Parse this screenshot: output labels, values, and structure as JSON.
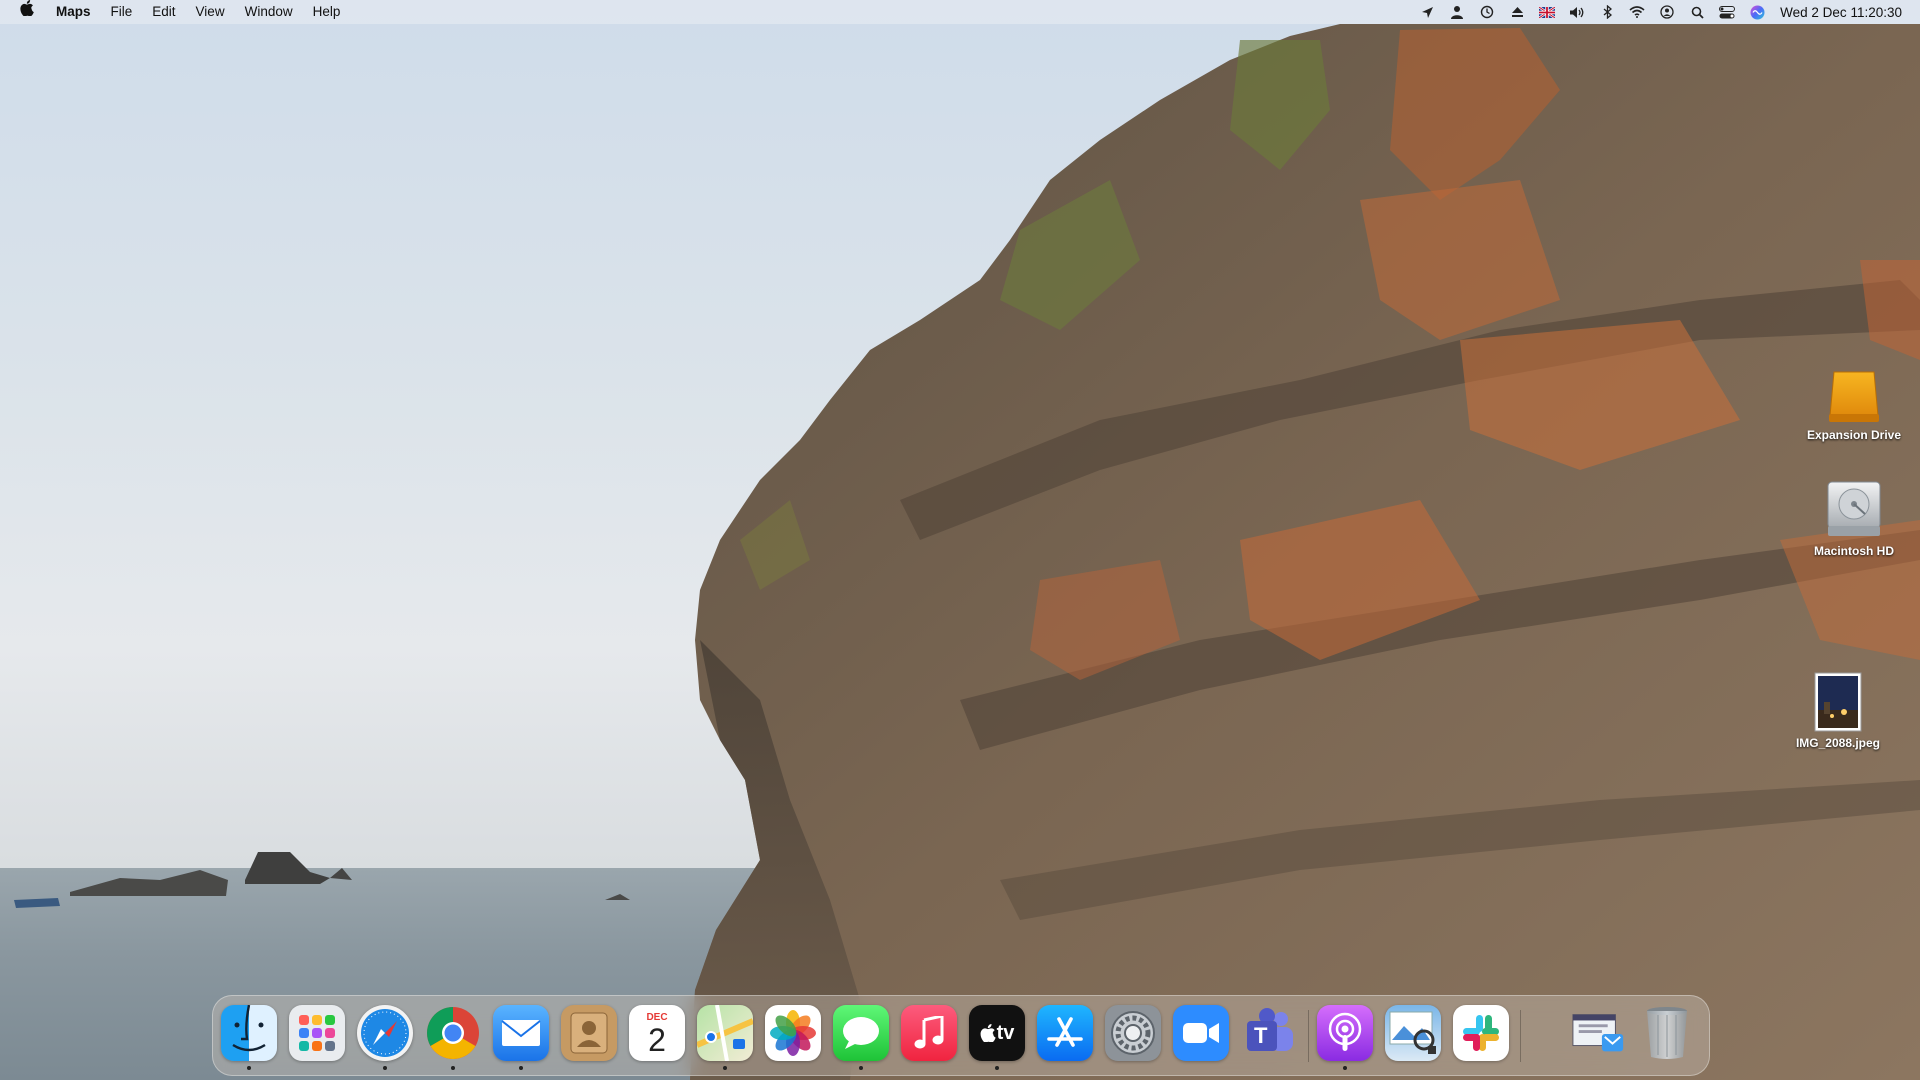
{
  "menubar": {
    "app_name": "Maps",
    "menus": [
      "File",
      "Edit",
      "View",
      "Window",
      "Help"
    ],
    "clock": "Wed 2 Dec  11:20:30",
    "status_icons": [
      "location-arrow-icon",
      "user-icon",
      "time-machine-icon",
      "eject-icon",
      "uk-flag-icon",
      "volume-icon",
      "bluetooth-icon",
      "wifi-icon",
      "user-circle-icon",
      "search-icon",
      "control-center-icon",
      "siri-icon"
    ]
  },
  "desktop": {
    "items": [
      {
        "label": "Expansion Drive",
        "icon": "external-drive-icon"
      },
      {
        "label": "Macintosh HD",
        "icon": "hard-drive-icon"
      },
      {
        "label": "IMG_2088.jpeg",
        "icon": "image-file-icon"
      }
    ]
  },
  "dock": {
    "calendar_month": "DEC",
    "calendar_day": "2",
    "tv_label": "tv",
    "teams_label": "T",
    "apps": [
      {
        "name": "Finder",
        "icon": "finder-icon",
        "running": true
      },
      {
        "name": "Launchpad",
        "icon": "launchpad-icon",
        "running": false
      },
      {
        "name": "Safari",
        "icon": "safari-icon",
        "running": true
      },
      {
        "name": "Google Chrome",
        "icon": "chrome-icon",
        "running": true
      },
      {
        "name": "Mail",
        "icon": "mail-icon",
        "running": true
      },
      {
        "name": "Contacts",
        "icon": "contacts-icon",
        "running": false
      },
      {
        "name": "Calendar",
        "icon": "calendar-icon",
        "running": false
      },
      {
        "name": "Maps",
        "icon": "maps-icon",
        "running": true
      },
      {
        "name": "Photos",
        "icon": "photos-icon",
        "running": false
      },
      {
        "name": "Messages",
        "icon": "messages-icon",
        "running": true
      },
      {
        "name": "Music",
        "icon": "music-icon",
        "running": false
      },
      {
        "name": "TV",
        "icon": "tv-icon",
        "running": true
      },
      {
        "name": "App Store",
        "icon": "app-store-icon",
        "running": false
      },
      {
        "name": "System Preferences",
        "icon": "system-preferences-icon",
        "running": false
      },
      {
        "name": "Zoom",
        "icon": "zoom-icon",
        "running": false
      },
      {
        "name": "Microsoft Teams",
        "icon": "teams-icon",
        "running": false
      },
      {
        "name": "Podcasts",
        "icon": "podcasts-icon",
        "running": true
      },
      {
        "name": "Preview",
        "icon": "preview-icon",
        "running": false
      },
      {
        "name": "Slack",
        "icon": "slack-icon",
        "running": false
      },
      {
        "name": "Mail Downloads",
        "icon": "downloads-stack-icon",
        "running": false
      },
      {
        "name": "Trash",
        "icon": "trash-icon",
        "running": false
      }
    ]
  },
  "colors": {
    "sky": "#d5dfe8",
    "rock": "#6b5a4a",
    "lichen": "#c4683a",
    "dock_bg": "#c8beb4"
  }
}
